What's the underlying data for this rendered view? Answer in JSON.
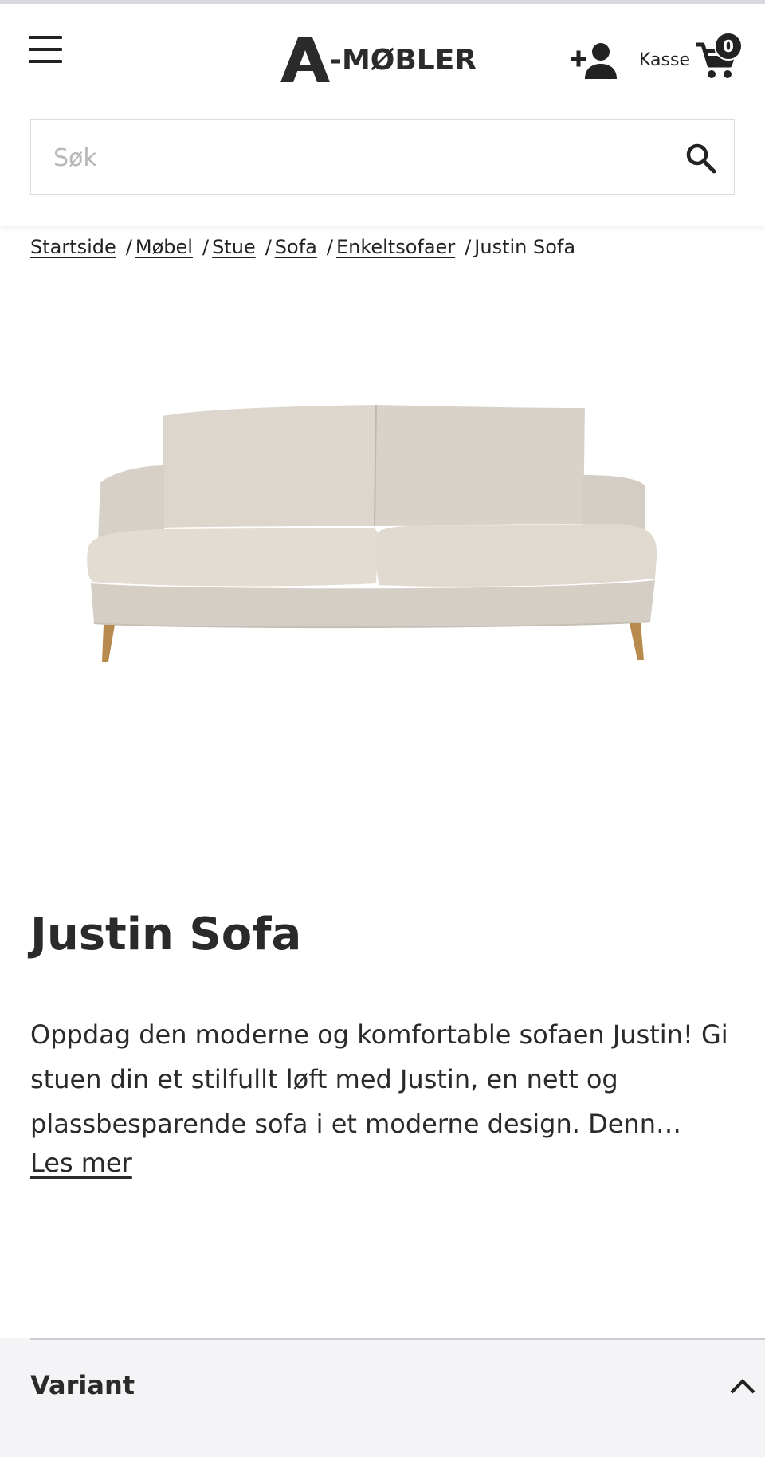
{
  "header": {
    "logo_text": "-MØBLER",
    "checkout_label": "Kasse",
    "cart_count": "0"
  },
  "search": {
    "placeholder": "Søk"
  },
  "breadcrumb": {
    "items": [
      "Startside",
      "Møbel",
      "Stue",
      "Sofa",
      "Enkeltsofaer"
    ],
    "current": "Justin Sofa",
    "separator": "/"
  },
  "product": {
    "title": "Justin Sofa",
    "description": "Oppdag den moderne og komfortable sofaen Justin! Gi stuen din et stilfullt løft med Justin, en nett og plassbesparende sofa i et moderne design. Denn…",
    "read_more": "Les mer"
  },
  "variant": {
    "title": "Variant"
  },
  "icons": {
    "menu": "hamburger-menu-icon",
    "account": "add-user-icon",
    "cart": "shopping-cart-icon",
    "search": "search-icon",
    "collapse": "chevron-up-icon"
  },
  "colors": {
    "text": "#222222",
    "variant_bg": "#f4f3f6",
    "sofa_fabric": "#d9d3ca",
    "sofa_legs": "#b88a4e"
  }
}
